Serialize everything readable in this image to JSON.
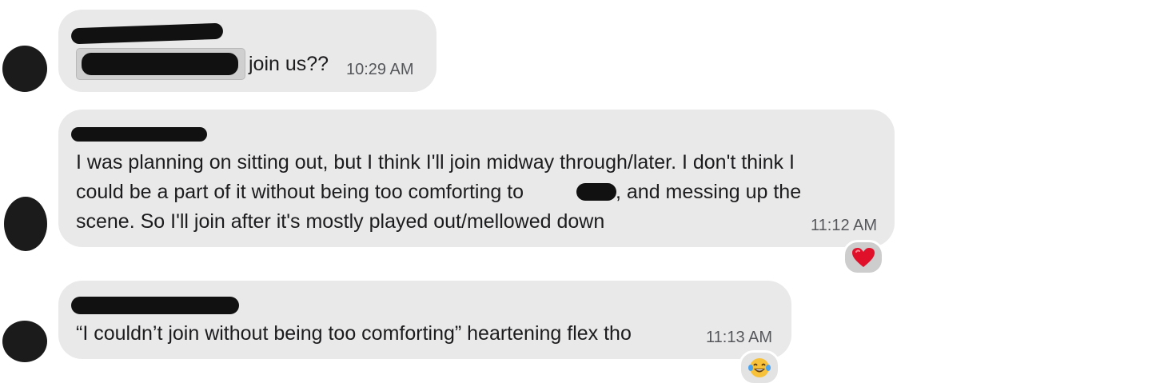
{
  "messages": [
    {
      "text": "join us??",
      "time": "10:29 AM"
    },
    {
      "lines": [
        "I was planning on sitting out, but I think I'll join midway through/later. I don't think I",
        "could be a part of it without being too comforting to",
        ", and messing up the",
        "scene. So I'll join after it's mostly played out/mellowed down"
      ],
      "time": "11:12 AM",
      "reaction": {
        "icon": "red-heart-icon",
        "color": "#e0102a"
      }
    },
    {
      "text": "“I couldn’t join without being too comforting” heartening flex tho",
      "time": "11:13 AM",
      "reaction": {
        "icon": "laughing-tears-icon",
        "color": "#f7c13a"
      }
    }
  ]
}
